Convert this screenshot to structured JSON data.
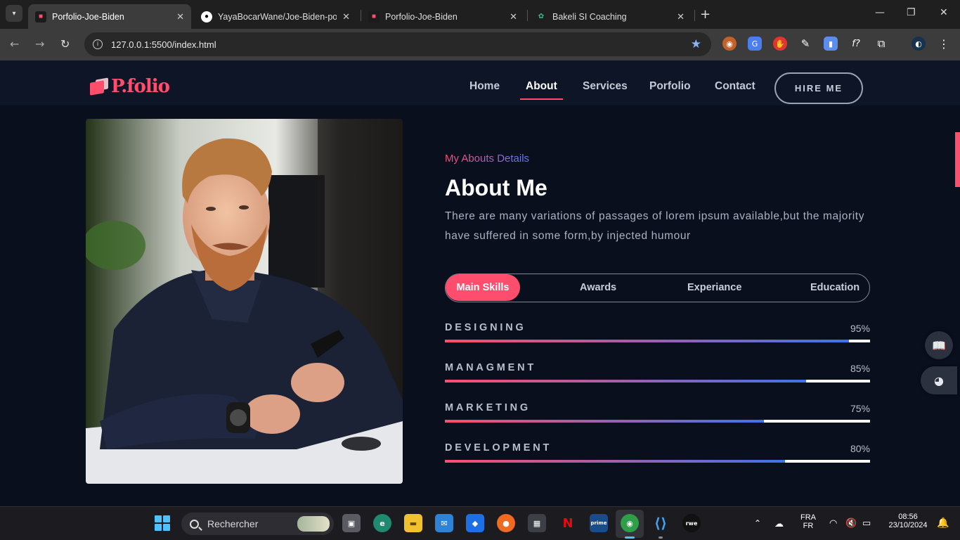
{
  "browser": {
    "tabs": [
      {
        "title": "Porfolio-Joe-Biden",
        "favicon": "portfolio-logo-icon",
        "active": true
      },
      {
        "title": "YayaBocarWane/Joe-Biden-porf",
        "favicon": "github-icon",
        "active": false
      },
      {
        "title": "Porfolio-Joe-Biden",
        "favicon": "portfolio-logo-icon",
        "active": false
      },
      {
        "title": "Bakeli SI Coaching",
        "favicon": "bakeli-icon",
        "active": false
      }
    ],
    "url": "127.0.0.1:5500/index.html",
    "extensions": [
      "chrome-extension-icon",
      "google-translate-icon",
      "adblock-icon",
      "eyedropper-icon",
      "docs-icon",
      "formula-icon",
      "puzzle-icon",
      "profile-avatar-icon"
    ]
  },
  "site": {
    "logo": "P.folio",
    "nav": [
      "Home",
      "About",
      "Services",
      "Porfolio",
      "Contact"
    ],
    "active_nav": "About",
    "cta": "HIRE ME"
  },
  "about": {
    "eyebrow": "My Abouts Details",
    "title": "About Me",
    "intro": "There are many variations of passages of lorem ipsum available,but the majority have suffered in some form,by injected humour",
    "tabs": [
      "Main Skills",
      "Awards",
      "Experiance",
      "Education"
    ],
    "active_tab": "Main Skills",
    "skills": [
      {
        "name": "DESIGNING",
        "percent_label": "95%",
        "value": 0.95
      },
      {
        "name": "MANAGMENT",
        "percent_label": "85%",
        "value": 0.85
      },
      {
        "name": "MARKETING",
        "percent_label": "75%",
        "value": 0.75
      },
      {
        "name": "DEVELOPMENT",
        "percent_label": "80%",
        "value": 0.8
      }
    ]
  },
  "colors": {
    "accent": "#ff4d6d",
    "gradient_end": "#3f73ea",
    "page_bg": "#0a0f1e"
  },
  "taskbar": {
    "search_placeholder": "Rechercher",
    "language_top": "FRA",
    "language_bottom": "FR",
    "time": "08:56",
    "date": "23/10/2024",
    "apps": [
      "task-view-icon",
      "edge-icon",
      "file-explorer-icon",
      "mail-icon",
      "dropbox-icon",
      "firefox-icon",
      "store-icon",
      "netflix-icon",
      "prime-video-icon",
      "chrome-icon",
      "vscode-icon",
      "ryve-icon"
    ]
  }
}
